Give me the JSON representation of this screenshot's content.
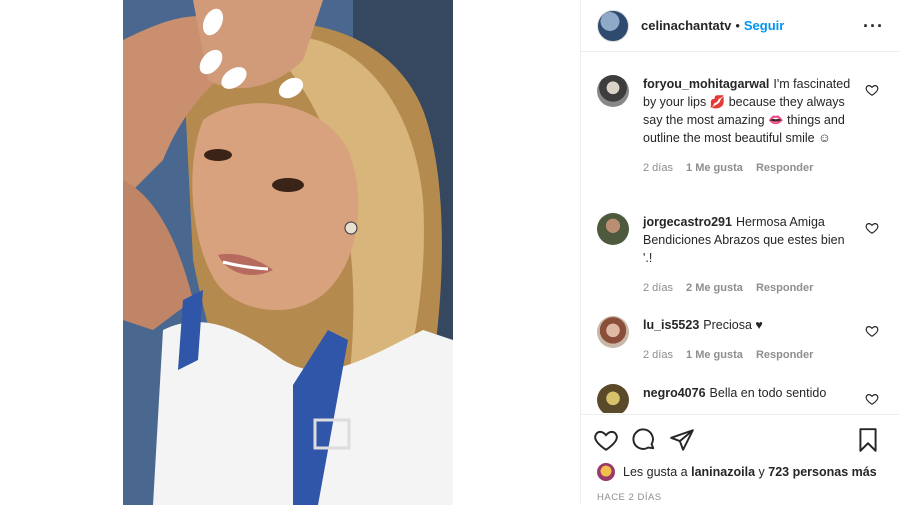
{
  "post": {
    "owner": "celinachantatv",
    "dot": "•",
    "follow_label": "Seguir",
    "more_icon": "more-options-icon"
  },
  "comments": [
    {
      "username": "foryou_mohitagarwal",
      "text": "I'm fascinated by your lips 💋 because they always say the most amazing 👄 things and outline the most beautiful smile ☺",
      "time": "2 días",
      "likes": "1 Me gusta",
      "reply": "Responder"
    },
    {
      "username": "jorgecastro291",
      "text": "Hermosa Amiga Bendiciones Abrazos que estes bien '.!",
      "time": "2 días",
      "likes": "2 Me gusta",
      "reply": "Responder"
    },
    {
      "username": "lu_is5523",
      "text": "Preciosa ♥",
      "time": "2 días",
      "likes": "1 Me gusta",
      "reply": "Responder"
    },
    {
      "username": "negro4076",
      "text": "Bella en todo sentido",
      "time": "",
      "likes": "",
      "reply": ""
    }
  ],
  "actions": {
    "like_icon": "heart-icon",
    "comment_icon": "comment-icon",
    "share_icon": "share-icon",
    "save_icon": "bookmark-icon"
  },
  "likes": {
    "prefix": "Les gusta a",
    "user": "laninazoila",
    "middle": "y",
    "others": "723 personas más"
  },
  "time_ago": "HACE 2 DÍAS",
  "colors": {
    "accent": "#0095f6",
    "text": "#262626",
    "muted": "#8e8e8e",
    "border": "#efefef"
  }
}
